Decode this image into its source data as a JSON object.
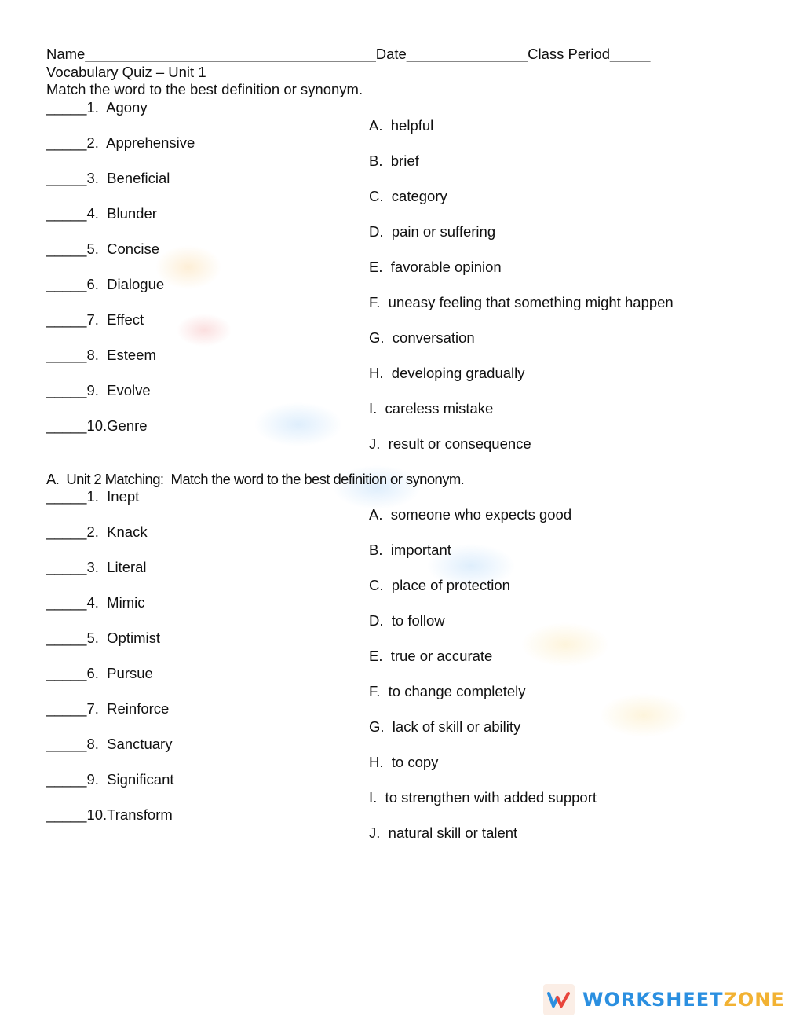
{
  "header": {
    "name_line": "Name____________________________________Date_______________Class Period_____",
    "title": "Vocabulary Quiz – Unit 1",
    "instruction": "Match the word to the best definition or synonym."
  },
  "unit1": {
    "words": [
      "_____1.  Agony",
      "_____2.  Apprehensive",
      "_____3.  Beneficial",
      "_____4.  Blunder",
      "_____5.  Concise",
      "_____6.  Dialogue",
      "_____7.  Effect",
      "_____8.  Esteem",
      "_____9.  Evolve",
      "_____10.Genre"
    ],
    "definitions": [
      "A.  helpful",
      "B.  brief",
      "C.  category",
      "D.  pain or suffering",
      "E.  favorable opinion",
      "F.  uneasy feeling that something might happen",
      "G.  conversation",
      "H.  developing gradually",
      "I.  careless mistake",
      "J.  result or consequence"
    ]
  },
  "unit2": {
    "heading": "A.  Unit 2 Matching:  Match the word to the best definition or synonym.",
    "words": [
      "_____1.  Inept",
      "_____2.  Knack",
      "_____3.  Literal",
      "_____4.  Mimic",
      "_____5.  Optimist",
      "_____6.  Pursue",
      "_____7.  Reinforce",
      "_____8.  Sanctuary",
      "_____9.  Significant",
      "_____10.Transform"
    ],
    "definitions": [
      "A.  someone who expects good",
      "B.  important",
      "C.  place of protection",
      "D.  to follow",
      "E.  true or accurate",
      "F.  to change completely",
      "G.  lack of skill or ability",
      "H.  to copy",
      "I.  to strengthen with added support",
      "J.  natural skill or talent"
    ]
  },
  "branding": {
    "logo_icon": "worksheetzone-w-icon",
    "text_part1": "WORKSHEET",
    "text_part2": "ZONE",
    "color_part1": "#2b8fe0",
    "color_part2": "#f2b233"
  }
}
